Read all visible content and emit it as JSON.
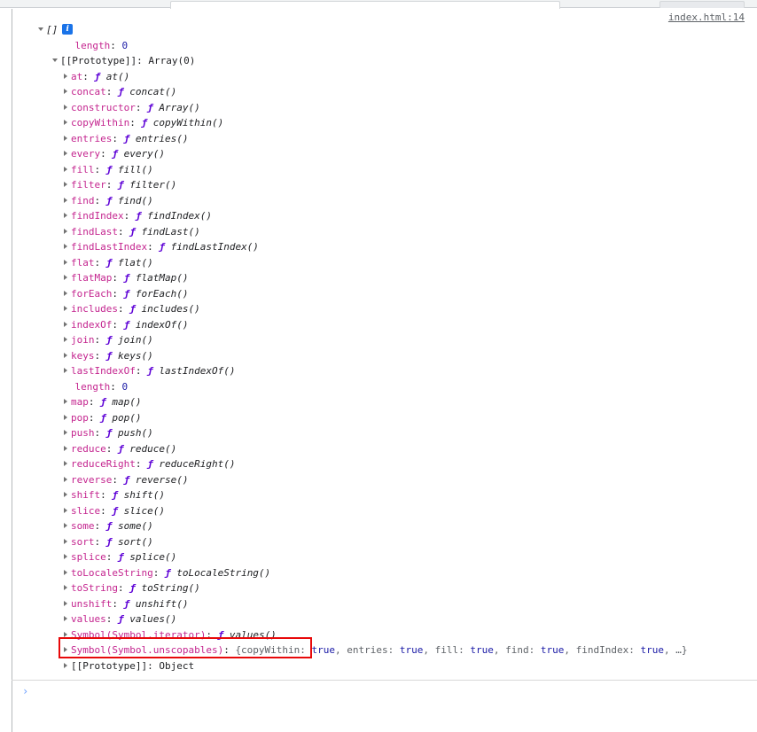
{
  "window": {
    "toolbar_visible_sliver": true
  },
  "console": {
    "source_link": "index.html:14",
    "info_badge_glyph": "i",
    "prompt_caret": "›",
    "prompt_value": "",
    "root": {
      "label": "[]",
      "expanded": true
    },
    "rows": [
      {
        "indent": 1,
        "marker": "none",
        "name": "length",
        "sep": ": ",
        "value": "0",
        "value_kind": "number"
      },
      {
        "indent": 0,
        "marker": "down",
        "name": "[[Prototype]]",
        "sep": ": ",
        "value": "Array(0)",
        "value_kind": "internal"
      },
      {
        "indent": 1,
        "marker": "right",
        "name": "at",
        "sep": ": ",
        "value": "at()",
        "value_kind": "function"
      },
      {
        "indent": 1,
        "marker": "right",
        "name": "concat",
        "sep": ": ",
        "value": "concat()",
        "value_kind": "function"
      },
      {
        "indent": 1,
        "marker": "right",
        "name": "constructor",
        "sep": ": ",
        "value": "Array()",
        "value_kind": "function"
      },
      {
        "indent": 1,
        "marker": "right",
        "name": "copyWithin",
        "sep": ": ",
        "value": "copyWithin()",
        "value_kind": "function"
      },
      {
        "indent": 1,
        "marker": "right",
        "name": "entries",
        "sep": ": ",
        "value": "entries()",
        "value_kind": "function"
      },
      {
        "indent": 1,
        "marker": "right",
        "name": "every",
        "sep": ": ",
        "value": "every()",
        "value_kind": "function"
      },
      {
        "indent": 1,
        "marker": "right",
        "name": "fill",
        "sep": ": ",
        "value": "fill()",
        "value_kind": "function"
      },
      {
        "indent": 1,
        "marker": "right",
        "name": "filter",
        "sep": ": ",
        "value": "filter()",
        "value_kind": "function"
      },
      {
        "indent": 1,
        "marker": "right",
        "name": "find",
        "sep": ": ",
        "value": "find()",
        "value_kind": "function"
      },
      {
        "indent": 1,
        "marker": "right",
        "name": "findIndex",
        "sep": ": ",
        "value": "findIndex()",
        "value_kind": "function"
      },
      {
        "indent": 1,
        "marker": "right",
        "name": "findLast",
        "sep": ": ",
        "value": "findLast()",
        "value_kind": "function"
      },
      {
        "indent": 1,
        "marker": "right",
        "name": "findLastIndex",
        "sep": ": ",
        "value": "findLastIndex()",
        "value_kind": "function"
      },
      {
        "indent": 1,
        "marker": "right",
        "name": "flat",
        "sep": ": ",
        "value": "flat()",
        "value_kind": "function"
      },
      {
        "indent": 1,
        "marker": "right",
        "name": "flatMap",
        "sep": ": ",
        "value": "flatMap()",
        "value_kind": "function"
      },
      {
        "indent": 1,
        "marker": "right",
        "name": "forEach",
        "sep": ": ",
        "value": "forEach()",
        "value_kind": "function"
      },
      {
        "indent": 1,
        "marker": "right",
        "name": "includes",
        "sep": ": ",
        "value": "includes()",
        "value_kind": "function"
      },
      {
        "indent": 1,
        "marker": "right",
        "name": "indexOf",
        "sep": ": ",
        "value": "indexOf()",
        "value_kind": "function"
      },
      {
        "indent": 1,
        "marker": "right",
        "name": "join",
        "sep": ": ",
        "value": "join()",
        "value_kind": "function"
      },
      {
        "indent": 1,
        "marker": "right",
        "name": "keys",
        "sep": ": ",
        "value": "keys()",
        "value_kind": "function"
      },
      {
        "indent": 1,
        "marker": "right",
        "name": "lastIndexOf",
        "sep": ": ",
        "value": "lastIndexOf()",
        "value_kind": "function"
      },
      {
        "indent": 1,
        "marker": "none",
        "name": "length",
        "sep": ": ",
        "value": "0",
        "value_kind": "number"
      },
      {
        "indent": 1,
        "marker": "right",
        "name": "map",
        "sep": ": ",
        "value": "map()",
        "value_kind": "function"
      },
      {
        "indent": 1,
        "marker": "right",
        "name": "pop",
        "sep": ": ",
        "value": "pop()",
        "value_kind": "function"
      },
      {
        "indent": 1,
        "marker": "right",
        "name": "push",
        "sep": ": ",
        "value": "push()",
        "value_kind": "function"
      },
      {
        "indent": 1,
        "marker": "right",
        "name": "reduce",
        "sep": ": ",
        "value": "reduce()",
        "value_kind": "function"
      },
      {
        "indent": 1,
        "marker": "right",
        "name": "reduceRight",
        "sep": ": ",
        "value": "reduceRight()",
        "value_kind": "function"
      },
      {
        "indent": 1,
        "marker": "right",
        "name": "reverse",
        "sep": ": ",
        "value": "reverse()",
        "value_kind": "function"
      },
      {
        "indent": 1,
        "marker": "right",
        "name": "shift",
        "sep": ": ",
        "value": "shift()",
        "value_kind": "function"
      },
      {
        "indent": 1,
        "marker": "right",
        "name": "slice",
        "sep": ": ",
        "value": "slice()",
        "value_kind": "function"
      },
      {
        "indent": 1,
        "marker": "right",
        "name": "some",
        "sep": ": ",
        "value": "some()",
        "value_kind": "function"
      },
      {
        "indent": 1,
        "marker": "right",
        "name": "sort",
        "sep": ": ",
        "value": "sort()",
        "value_kind": "function"
      },
      {
        "indent": 1,
        "marker": "right",
        "name": "splice",
        "sep": ": ",
        "value": "splice()",
        "value_kind": "function"
      },
      {
        "indent": 1,
        "marker": "right",
        "name": "toLocaleString",
        "sep": ": ",
        "value": "toLocaleString()",
        "value_kind": "function"
      },
      {
        "indent": 1,
        "marker": "right",
        "name": "toString",
        "sep": ": ",
        "value": "toString()",
        "value_kind": "function"
      },
      {
        "indent": 1,
        "marker": "right",
        "name": "unshift",
        "sep": ": ",
        "value": "unshift()",
        "value_kind": "function"
      },
      {
        "indent": 1,
        "marker": "right",
        "name": "values",
        "sep": ": ",
        "value": "values()",
        "value_kind": "function"
      },
      {
        "indent": 1,
        "marker": "right",
        "name": "Symbol(Symbol.iterator)",
        "sep": ": ",
        "value": "values()",
        "value_kind": "function",
        "highlighted": true
      },
      {
        "indent": 1,
        "marker": "right",
        "name": "Symbol(Symbol.unscopables)",
        "sep": ": ",
        "value": "{copyWithin: true, entries: true, fill: true, find: true, findIndex: true, …}",
        "value_kind": "object_preview"
      },
      {
        "indent": 1,
        "marker": "right",
        "name": "[[Prototype]]",
        "sep": ": ",
        "value": "Object",
        "value_kind": "internal"
      }
    ]
  },
  "annotation": {
    "highlight_color": "#e8090a",
    "target_row_label": "Symbol(Symbol.iterator): ƒ values()"
  },
  "colors": {
    "property_name": "#c4258f",
    "number": "#1a1aa6",
    "boolean": "#1a1aa6",
    "function_glyph": "#5d00d6",
    "plain_text": "#202124",
    "preview_text": "#5f6368",
    "link": "#5f6368",
    "info_badge_bg": "#1a73e8",
    "prompt_caret": "#6a9eff",
    "highlight": "#e8090a"
  }
}
